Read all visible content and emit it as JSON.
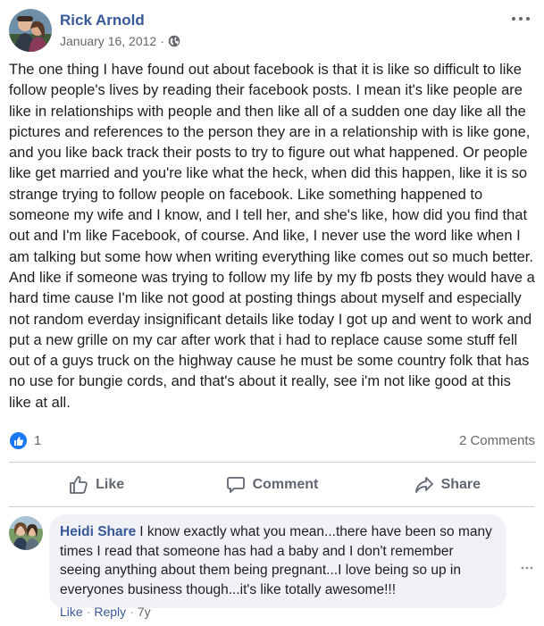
{
  "post": {
    "author": "Rick Arnold",
    "date": "January 16, 2012",
    "meta_separator": "·",
    "privacy_icon": "globe-icon",
    "body": "The one thing I have found out about facebook is that it is like so difficult to like follow people's lives by reading their facebook posts. I mean it's like people are like in relationships with people and then like all of a sudden one day like all the pictures and references to the person they are in a relationship with is like gone, and you like back track their posts to try to figure out what happened. Or people like get married and you're like what the heck, when did this happen, like it is so strange trying to follow people on facebook. Like something happened to someone my wife and I know, and I tell her, and she's like, how did you find that out and I'm like Facebook, of course. And like, I never use the word like when I am talking but some how when writing everything like comes out so much better. And like if someone was trying to follow my life by my fb posts they would have a hard time cause I'm like not good at posting things about myself and especially not random everday insignificant details like today I got up and went to work and put a new grille on my car after work that i had to replace cause some stuff fell out of a guys truck on the highway cause he must be some country folk that has no use for bungie cords, and that's about it really, see i'm not like good at this like at all."
  },
  "reactions": {
    "count": "1",
    "comments_label": "2 Comments"
  },
  "actions": {
    "like": "Like",
    "comment": "Comment",
    "share": "Share"
  },
  "comment": {
    "author": "Heidi Share",
    "text": "I know exactly what you mean...there have been so many times I read that someone has had a baby and I don't remember seeing anything about them being pregnant...I love being so up in everyones business though...it's like totally awesome!!!",
    "like": "Like",
    "reply": "Reply",
    "separator": "·",
    "time": "7y"
  },
  "colors": {
    "name_link": "#385898",
    "like_blue": "#1877f2",
    "muted": "#65676b",
    "bubble": "#f0f2f5"
  }
}
